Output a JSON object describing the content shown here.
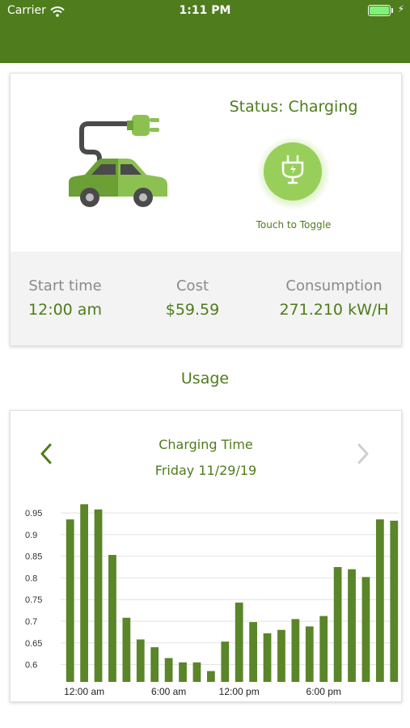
{
  "status_bar": {
    "carrier": "Carrier",
    "time": "1:11 PM"
  },
  "status_card": {
    "status_text": "Status: Charging",
    "toggle_label": "Touch to Toggle",
    "stats": [
      {
        "label": "Start time",
        "value": "12:00 am"
      },
      {
        "label": "Cost",
        "value": "$59.59"
      },
      {
        "label": "Consumption",
        "value": "271.210 kW/H"
      }
    ]
  },
  "usage_title": "Usage",
  "chart_card": {
    "title": "Charging Time",
    "date": "Friday 11/29/19"
  },
  "colors": {
    "brand": "#4f7c1c",
    "accent_light": "#98cf5b",
    "bar": "#5a8528"
  },
  "icons": {
    "nav_prev": "chevron-left-icon",
    "nav_next": "chevron-right-icon",
    "toggle": "plug-icon",
    "illustration": "electric-car-icon"
  },
  "chart_data": {
    "type": "bar",
    "title": "",
    "xlabel": "",
    "ylabel": "",
    "ylim": [
      0.56,
      0.98
    ],
    "yticks": [
      0.6,
      0.65,
      0.7,
      0.75,
      0.8,
      0.85,
      0.9,
      0.95
    ],
    "ytick_labels": [
      "0.6",
      "0.65",
      "0.7",
      "0.75",
      "0.8",
      "0.85",
      "0.9",
      "0.95"
    ],
    "xtick_labels": [
      {
        "index": 1,
        "label": "12:00 am"
      },
      {
        "index": 7,
        "label": "6:00 am"
      },
      {
        "index": 12,
        "label": "12:00 pm"
      },
      {
        "index": 18,
        "label": "6:00 pm"
      }
    ],
    "grid": true,
    "series": [
      {
        "values": [
          0.935,
          0.97,
          0.958,
          0.853,
          0.708,
          0.658,
          0.64,
          0.615,
          0.605,
          0.605,
          0.585,
          0.653,
          0.743,
          0.698,
          0.672,
          0.68,
          0.705,
          0.688,
          0.712,
          0.825,
          0.82,
          0.802,
          0.935,
          0.932
        ]
      }
    ]
  }
}
